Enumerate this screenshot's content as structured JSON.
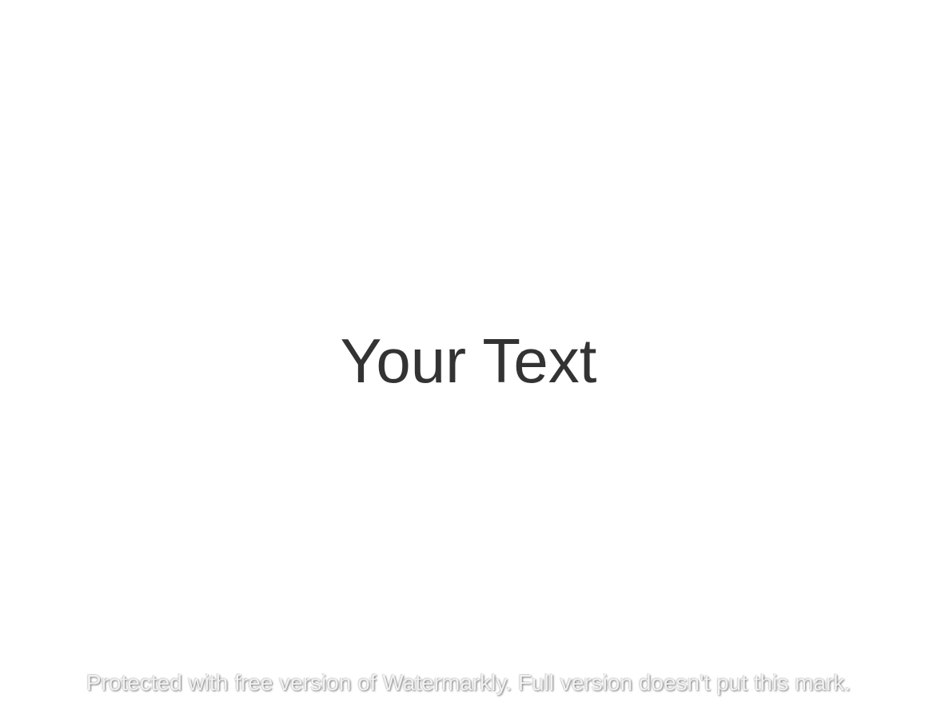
{
  "canvas": {
    "background_color": "#ffffff"
  },
  "main": {
    "text": "Your Text",
    "color": "#333333"
  },
  "watermark": {
    "text": "Protected with free version of Watermarkly. Full version doesn't put this mark."
  }
}
